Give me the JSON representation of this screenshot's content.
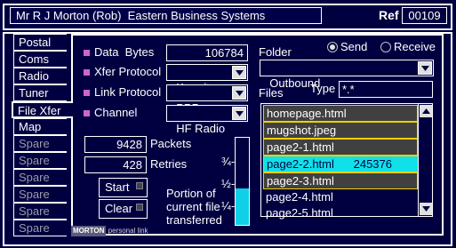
{
  "header": {
    "user_text": "Mr R J Morton (Rob)  Eastern Business Systems",
    "ref_label": "Ref",
    "ref_value": "00109"
  },
  "tabs": [
    {
      "label": "Postal",
      "state": "normal"
    },
    {
      "label": "Coms",
      "state": "normal"
    },
    {
      "label": "Radio",
      "state": "normal"
    },
    {
      "label": "Tuner",
      "state": "normal"
    },
    {
      "label": "File Xfer",
      "state": "active"
    },
    {
      "label": "Map",
      "state": "normal"
    },
    {
      "label": "Spare",
      "state": "disabled"
    },
    {
      "label": "Spare",
      "state": "disabled"
    },
    {
      "label": "Spare",
      "state": "disabled"
    },
    {
      "label": "Spare",
      "state": "disabled"
    },
    {
      "label": "Spare",
      "state": "disabled"
    },
    {
      "label": "Spare",
      "state": "disabled"
    }
  ],
  "xfer": {
    "data_label": "Data  Bytes",
    "data_value": "106784",
    "protocol_label": "Xfer Protocol",
    "protocol_value": "Kermit",
    "link_label": "Link Protocol",
    "link_value": "PPP",
    "channel_label": "Channel",
    "channel_value": "HF Radio"
  },
  "folder": {
    "label": "Folder",
    "value": "Outbound",
    "send_label": "Send",
    "receive_label": "Receive",
    "selected_mode": "Send"
  },
  "files": {
    "label": "Files",
    "type_label": "Type",
    "type_value": "*.*",
    "items": [
      {
        "name": "homepage.html",
        "size": "",
        "state": "highlight"
      },
      {
        "name": "mugshot.jpeg",
        "size": "",
        "state": "highlight"
      },
      {
        "name": "page2-1.html",
        "size": "",
        "state": "highlight"
      },
      {
        "name": "page2-2.html",
        "size": "245376",
        "state": "selected"
      },
      {
        "name": "page2-3.html",
        "size": "",
        "state": "highlight"
      },
      {
        "name": "page2-4.html",
        "size": "",
        "state": "plain"
      },
      {
        "name": "page2-5.html",
        "size": "",
        "state": "plain"
      }
    ]
  },
  "counters": {
    "packets_value": "9428",
    "packets_label": "Packets",
    "retries_value": "428",
    "retries_label": "Retries"
  },
  "buttons": {
    "start_label": "Start",
    "clear_label": "Clear"
  },
  "progress": {
    "fraction": 0.42,
    "tick_three_quarter": "¾-",
    "tick_half": "½-",
    "tick_quarter": "¼-",
    "caption_line1": "Portion of",
    "caption_line2": "current file",
    "caption_line3": "transferred"
  },
  "branding": {
    "logo": "MORTON",
    "tagline": "personal link"
  },
  "colors": {
    "background": "#000040",
    "accent_selected": "#10e0e8",
    "highlight_border": "#f0d000",
    "bullet": "#cc66cc",
    "progress_fill": "#10d0e8"
  }
}
